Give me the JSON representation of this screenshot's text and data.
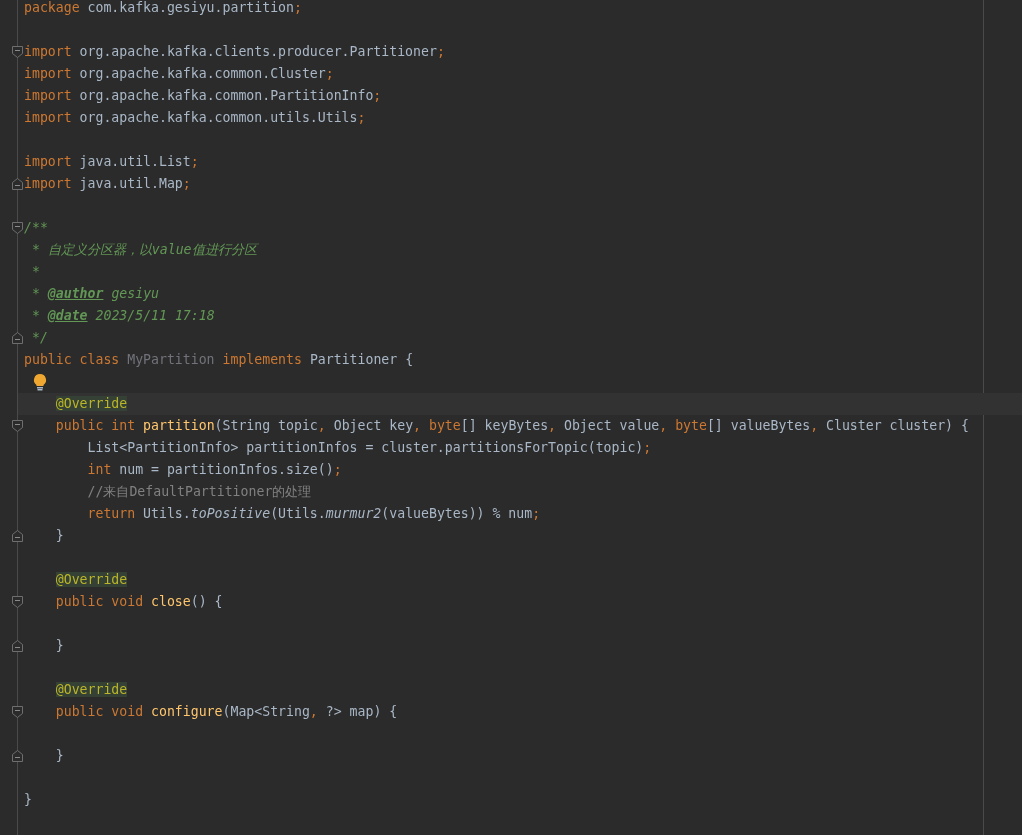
{
  "editor": {
    "blocks": [
      {
        "lines": [
          {
            "tokens": [
              {
                "kind": "keyword",
                "text": "package"
              },
              {
                "kind": "plain",
                "text": " com.kafka.gesiyu.partition"
              },
              {
                "kind": "punct",
                "text": ";"
              }
            ]
          }
        ]
      },
      {
        "lines": [
          {
            "fold_start": true,
            "tokens": [
              {
                "kind": "keyword",
                "text": "import"
              },
              {
                "kind": "plain",
                "text": " org.apache.kafka.clients.producer.Partitioner"
              },
              {
                "kind": "punct",
                "text": ";"
              }
            ]
          },
          {
            "tokens": [
              {
                "kind": "keyword",
                "text": "import"
              },
              {
                "kind": "plain",
                "text": " org.apache.kafka.common.Cluster"
              },
              {
                "kind": "punct",
                "text": ";"
              }
            ]
          },
          {
            "tokens": [
              {
                "kind": "keyword",
                "text": "import"
              },
              {
                "kind": "plain",
                "text": " org.apache.kafka.common.PartitionInfo"
              },
              {
                "kind": "punct",
                "text": ";"
              }
            ]
          },
          {
            "tokens": [
              {
                "kind": "keyword",
                "text": "import"
              },
              {
                "kind": "plain",
                "text": " org.apache.kafka.common.utils.Utils"
              },
              {
                "kind": "punct",
                "text": ";"
              }
            ]
          }
        ]
      },
      {
        "lines": [
          {
            "tokens": [
              {
                "kind": "keyword",
                "text": "import"
              },
              {
                "kind": "plain",
                "text": " java.util.List"
              },
              {
                "kind": "punct",
                "text": ";"
              }
            ]
          },
          {
            "fold_end": true,
            "tokens": [
              {
                "kind": "keyword",
                "text": "import"
              },
              {
                "kind": "plain",
                "text": " java.util.Map"
              },
              {
                "kind": "punct",
                "text": ";"
              }
            ]
          }
        ]
      },
      {
        "lines": [
          {
            "fold_start": true,
            "tokens": [
              {
                "kind": "doc",
                "text": "/**"
              }
            ]
          },
          {
            "tokens": [
              {
                "kind": "doc",
                "text": " * 自定义分区器，以value值进行分区"
              }
            ]
          },
          {
            "tokens": [
              {
                "kind": "doc",
                "text": " *"
              }
            ]
          },
          {
            "tokens": [
              {
                "kind": "doc",
                "text": " * "
              },
              {
                "kind": "doctag",
                "text": "@author"
              },
              {
                "kind": "doc",
                "text": " gesiyu"
              }
            ]
          },
          {
            "tokens": [
              {
                "kind": "doc",
                "text": " * "
              },
              {
                "kind": "doctag",
                "text": "@date"
              },
              {
                "kind": "doc",
                "text": " 2023/5/11 17:18"
              }
            ]
          },
          {
            "fold_end": true,
            "tokens": [
              {
                "kind": "doc",
                "text": " */"
              }
            ]
          },
          {
            "tokens": [
              {
                "kind": "keyword",
                "text": "public class "
              },
              {
                "kind": "unused",
                "text": "MyPartition"
              },
              {
                "kind": "keyword",
                "text": " implements"
              },
              {
                "kind": "plain",
                "text": " Partitioner {"
              }
            ]
          },
          {
            "intention_bulb": true
          },
          {
            "current": true,
            "tokens": [
              {
                "kind": "annotation",
                "text": "    @Override"
              }
            ]
          },
          {
            "fold_start": true,
            "tokens": [
              {
                "kind": "keyword",
                "text": "    public int "
              },
              {
                "kind": "method",
                "text": "partition"
              },
              {
                "kind": "plain",
                "text": "(String topic"
              },
              {
                "kind": "punct",
                "text": ", "
              },
              {
                "kind": "plain",
                "text": "Object key"
              },
              {
                "kind": "punct",
                "text": ", "
              },
              {
                "kind": "keyword",
                "text": "byte"
              },
              {
                "kind": "plain",
                "text": "[] keyBytes"
              },
              {
                "kind": "punct",
                "text": ", "
              },
              {
                "kind": "plain",
                "text": "Object value"
              },
              {
                "kind": "punct",
                "text": ", "
              },
              {
                "kind": "keyword",
                "text": "byte"
              },
              {
                "kind": "plain",
                "text": "[] valueBytes"
              },
              {
                "kind": "punct",
                "text": ", "
              },
              {
                "kind": "plain",
                "text": "Cluster cluster) {"
              }
            ]
          },
          {
            "tokens": [
              {
                "kind": "plain",
                "text": "        List<PartitionInfo> partitionInfos = cluster.partitionsForTopic(topic)"
              },
              {
                "kind": "punct",
                "text": ";"
              }
            ]
          },
          {
            "tokens": [
              {
                "kind": "keyword",
                "text": "        int "
              },
              {
                "kind": "plain",
                "text": "num = partitionInfos.size()"
              },
              {
                "kind": "punct",
                "text": ";"
              }
            ]
          },
          {
            "tokens": [
              {
                "kind": "comment",
                "text": "        //来自DefaultPartitioner的处理"
              }
            ]
          },
          {
            "tokens": [
              {
                "kind": "keyword",
                "text": "        return "
              },
              {
                "kind": "plain",
                "text": "Utils."
              },
              {
                "kind": "static",
                "text": "toPositive"
              },
              {
                "kind": "plain",
                "text": "(Utils."
              },
              {
                "kind": "static",
                "text": "murmur2"
              },
              {
                "kind": "plain",
                "text": "(valueBytes)) % num"
              },
              {
                "kind": "punct",
                "text": ";"
              }
            ]
          },
          {
            "fold_end": true,
            "tokens": [
              {
                "kind": "plain",
                "text": "    }"
              }
            ]
          }
        ]
      },
      {
        "lines": [
          {
            "tokens": [
              {
                "kind": "annotation",
                "text": "    @Override"
              }
            ]
          },
          {
            "fold_start": true,
            "tokens": [
              {
                "kind": "keyword",
                "text": "    public void "
              },
              {
                "kind": "method",
                "text": "close"
              },
              {
                "kind": "plain",
                "text": "() {"
              }
            ]
          }
        ]
      },
      {
        "lines": [
          {
            "fold_end": true,
            "tokens": [
              {
                "kind": "plain",
                "text": "    }"
              }
            ]
          }
        ]
      },
      {
        "lines": [
          {
            "tokens": [
              {
                "kind": "annotation",
                "text": "    @Override"
              }
            ]
          },
          {
            "fold_start": true,
            "tokens": [
              {
                "kind": "keyword",
                "text": "    public void "
              },
              {
                "kind": "method",
                "text": "configure"
              },
              {
                "kind": "plain",
                "text": "(Map<String"
              },
              {
                "kind": "punct",
                "text": ", "
              },
              {
                "kind": "plain",
                "text": "?> map) {"
              }
            ]
          }
        ]
      },
      {
        "lines": [
          {
            "fold_end": true,
            "tokens": [
              {
                "kind": "plain",
                "text": "    }"
              }
            ]
          }
        ]
      },
      {
        "lines": [
          {
            "tokens": [
              {
                "kind": "plain",
                "text": "}"
              }
            ]
          }
        ]
      }
    ]
  }
}
